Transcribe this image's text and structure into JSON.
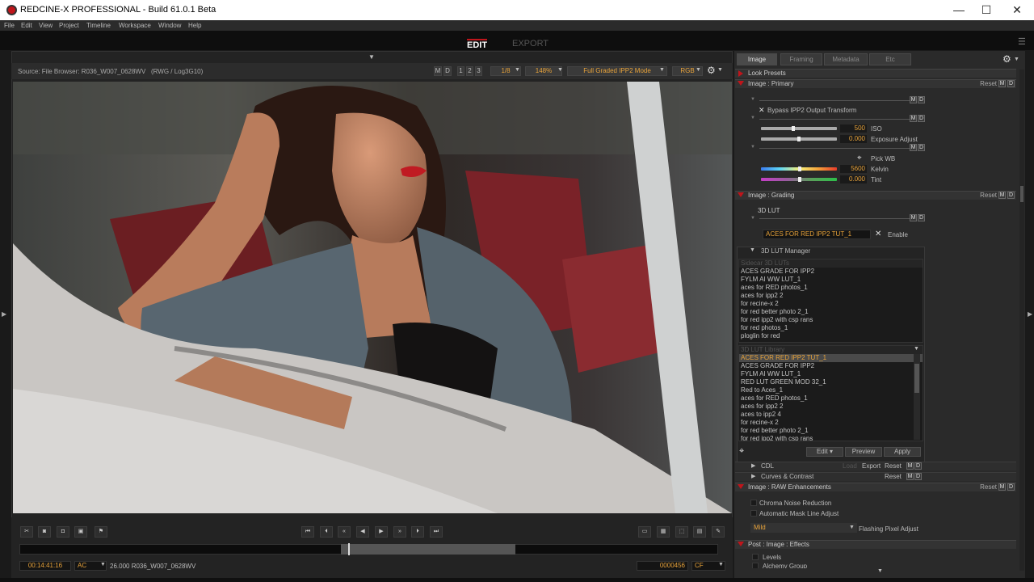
{
  "titlebar": {
    "title": "REDCINE-X PROFESSIONAL - Build 61.0.1 Beta",
    "minimize": "—",
    "maximize": "☐",
    "close": "✕"
  },
  "menu": [
    "File",
    "Edit",
    "View",
    "Project",
    "Timeline",
    "Workspace",
    "Window",
    "Help"
  ],
  "modes": {
    "edit": "EDIT",
    "export": "EXPORT"
  },
  "viewer": {
    "source": "Source: File Browser: R036_W007_0628WV",
    "format": "(RWG / Log3G10)",
    "m": "M",
    "d": "D",
    "n1": "1",
    "n2": "2",
    "n3": "3",
    "res": "1/8",
    "zoom": "148%",
    "mode": "Full Graded IPP2 Mode",
    "channel": "RGB"
  },
  "transport": {
    "timecode": "00:14:41:16",
    "ac": "AC",
    "clip": "26.000 R036_W007_0628WV",
    "frame": "0000456",
    "cf": "CF",
    "playhead_fraction": 0.47,
    "in_fraction": 0.46,
    "out_fraction": 0.71
  },
  "rtabs": [
    "Image",
    "Framing",
    "Metadata",
    "Etc"
  ],
  "look_presets": "Look Presets",
  "primary": {
    "title": "Image : Primary",
    "reset": "Reset",
    "bypass": "Bypass IPP2 Output Transform",
    "iso_label": "ISO",
    "iso": "500",
    "exposure_label": "Exposure Adjust",
    "exposure": "0.000",
    "pickwb": "Pick WB",
    "kelvin_label": "Kelvin",
    "kelvin": "5600",
    "tint_label": "Tint",
    "tint": "0.000"
  },
  "grading": {
    "title": "Image : Grading",
    "reset": "Reset",
    "lut3d": "3D LUT",
    "lut_value": "ACES FOR RED IPP2 TUT_1",
    "enable": "Enable",
    "manager": "3D LUT Manager",
    "sidecar_header": "Sidecar 3D LUTs",
    "sidecar": [
      "ACES GRADE FOR IPP2",
      "FYLM AI WW LUT_1",
      "aces for RED photos_1",
      "aces for ipp2 2",
      "for recine-x 2",
      "for red better photo 2_1",
      "for red ipp2 with csp rans",
      "for red photos_1",
      "ploglin for red"
    ],
    "library_header": "3D LUT Library",
    "library": [
      "ACES FOR RED IPP2 TUT_1",
      "ACES GRADE FOR IPP2",
      "FYLM AI WW LUT_1",
      "RED LUT GREEN MOD 32_1",
      "Red to Aces_1",
      "aces for RED photos_1",
      "aces for ipp2 2",
      "aces to ipp2 4",
      "for recine-x 2",
      "for red better photo 2_1",
      "for red ipp2 with csp rans"
    ],
    "edit": "Edit",
    "preview": "Preview",
    "apply": "Apply",
    "cdl": "CDL",
    "load": "Load",
    "export": "Export",
    "cdl_reset": "Reset",
    "curves": "Curves & Contrast",
    "curves_reset": "Reset"
  },
  "raw": {
    "title": "Image : RAW Enhancements",
    "reset": "Reset",
    "chroma": "Chroma Noise Reduction",
    "mask": "Automatic Mask Line Adjust",
    "mild": "Mild",
    "flash": "Flashing Pixel Adjust"
  },
  "post": {
    "title": "Post : Image : Effects",
    "levels": "Levels",
    "alchemy": "Alchemy Group"
  },
  "colors": {
    "accent": "#c0151b",
    "orange": "#e8a33a"
  }
}
